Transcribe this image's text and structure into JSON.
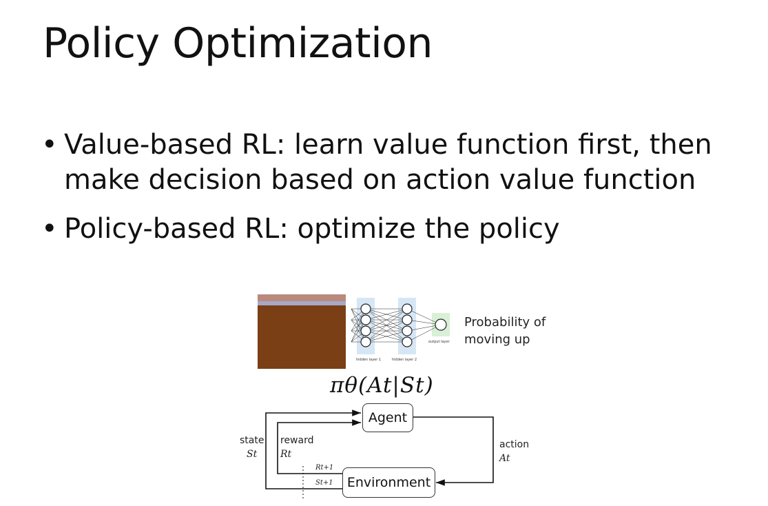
{
  "slide": {
    "title": "Policy Optimization",
    "bullets": [
      "Value-based RL: learn value function first, then make decision based on action value function",
      "Policy-based RL: optimize the policy"
    ]
  },
  "figure": {
    "probability_label": "Probability of moving up",
    "network_labels": {
      "hidden1": "hidden layer 1",
      "hidden2": "hidden layer 2",
      "output": "output layer"
    },
    "formula": "πθ(At|St)",
    "diagram": {
      "agent": "Agent",
      "environment": "Environment",
      "state_label": "state",
      "reward_label": "reward",
      "action_label": "action",
      "state_symbol": "St",
      "reward_symbol": "Rt",
      "action_symbol": "At",
      "next_reward_symbol": "Rt+1",
      "next_state_symbol": "St+1"
    }
  }
}
